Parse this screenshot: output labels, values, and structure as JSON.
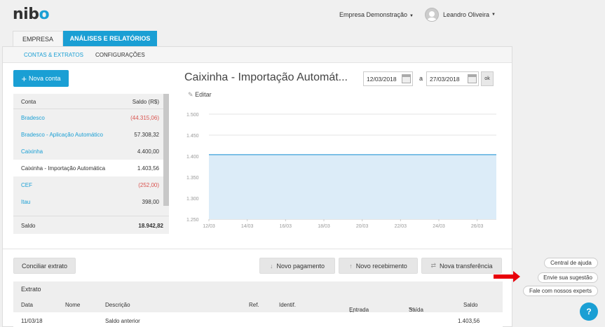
{
  "header": {
    "logo": "nibo",
    "company": "Empresa Demonstração",
    "user": "Leandro Oliveira"
  },
  "tabs": [
    "EMPRESA",
    "ANÁLISES E RELATÓRIOS"
  ],
  "subnav": [
    "CONTAS & EXTRATOS",
    "CONFIGURAÇÕES"
  ],
  "new_account_label": "Nova conta",
  "accounts": {
    "col_account": "Conta",
    "col_balance": "Saldo (R$)",
    "rows": [
      {
        "name": "Bradesco",
        "balance": "(44.315,06)"
      },
      {
        "name": "Bradesco - Aplicação Automático",
        "balance": "57.308,32"
      },
      {
        "name": "Caixinha",
        "balance": "4.400,00"
      },
      {
        "name": "Caixinha - Importação Automática",
        "balance": "1.403,56"
      },
      {
        "name": "CEF",
        "balance": "(252,00)"
      },
      {
        "name": "Itau",
        "balance": "398,00"
      }
    ],
    "total_label": "Saldo",
    "total_value": "18.942,82"
  },
  "detail": {
    "title": "Caixinha - Importação Automát...",
    "edit_label": "Editar",
    "date_from": "12/03/2018",
    "date_sep": "a",
    "date_to": "27/03/2018",
    "ok_label": "ok"
  },
  "chart_data": {
    "type": "area",
    "x": [
      "12/03",
      "13/03",
      "14/03",
      "15/03",
      "16/03",
      "17/03",
      "18/03",
      "19/03",
      "20/03",
      "21/03",
      "22/03",
      "23/03",
      "24/03",
      "25/03",
      "26/03",
      "27/03"
    ],
    "xticks": [
      "12/03",
      "14/03",
      "16/03",
      "18/03",
      "20/03",
      "22/03",
      "24/03",
      "26/03"
    ],
    "yticks": [
      "1.500",
      "1.450",
      "1.400",
      "1.350",
      "1.300",
      "1.250"
    ],
    "values": [
      1403.56,
      1403.56,
      1403.56,
      1403.56,
      1403.56,
      1403.56,
      1403.56,
      1403.56,
      1403.56,
      1403.56,
      1403.56,
      1403.56,
      1403.56,
      1403.56,
      1403.56,
      1403.56
    ],
    "ylim": [
      1250,
      1500
    ],
    "grid": true,
    "colors": {
      "line": "#5aaee0",
      "fill": "#dcecf8"
    }
  },
  "actions": {
    "conciliar": "Conciliar extrato",
    "pagamento": "Novo pagamento",
    "recebimento": "Novo recebimento",
    "transferencia": "Nova transferência"
  },
  "statement": {
    "title": "Extrato",
    "columns": [
      "Data",
      "Nome",
      "Descrição",
      "Ref.",
      "Identif.",
      "Entrada",
      "Saída",
      "Saldo"
    ],
    "row": {
      "date": "11/03/18",
      "description": "Saldo anterior",
      "balance": "1.403,56"
    }
  },
  "help": {
    "central": "Central de ajuda",
    "sugestao": "Envie sua sugestão",
    "experts": "Fale com nossos experts",
    "button": "?"
  }
}
